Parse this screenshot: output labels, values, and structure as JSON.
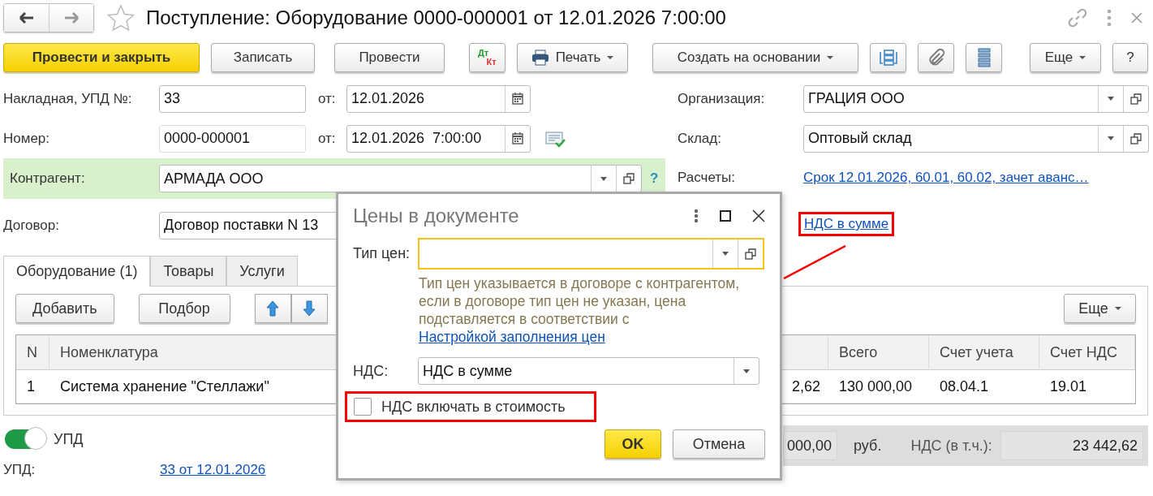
{
  "window": {
    "title": "Поступление: Оборудование 0000-000001 от 12.01.2026 7:00:00"
  },
  "toolbar": [
    {
      "kind": "primary",
      "label": "Провести и закрыть"
    },
    {
      "kind": "text",
      "label": "Записать"
    },
    {
      "kind": "text",
      "label": "Провести"
    },
    {
      "kind": "dtkt",
      "top": "Дт",
      "bottom": "Кт"
    },
    {
      "kind": "print",
      "label": "Печать"
    },
    {
      "kind": "menu",
      "label": "Создать на основании"
    },
    {
      "kind": "structure"
    },
    {
      "kind": "attach"
    },
    {
      "kind": "list"
    },
    {
      "kind": "menu",
      "label": "Еще"
    },
    {
      "kind": "text",
      "label": "?"
    }
  ],
  "invoice": {
    "label": "Накладная, УПД №:",
    "value": "33",
    "date_label": "от:",
    "date": "12.01.2026"
  },
  "number": {
    "label": "Номер:",
    "value": "0000-000001",
    "date_label": "от:",
    "date": "12.01.2026  7:00:00"
  },
  "counterparty": {
    "label": "Контрагент:",
    "value": "АРМАДА ООО",
    "help": "?"
  },
  "contract": {
    "label": "Договор:",
    "value": "Договор поставки N 13"
  },
  "organization": {
    "label": "Организация:",
    "value": "ГРАЦИЯ ООО"
  },
  "warehouse": {
    "label": "Склад:",
    "value": "Оптовый склад"
  },
  "settlements": {
    "label": "Расчеты:",
    "link": "Срок 12.01.2026, 60.01, 60.02, зачет аванс…"
  },
  "vat_link": "НДС в сумме",
  "tabs": [
    {
      "label": "Оборудование (1)",
      "selected": true
    },
    {
      "label": "Товары",
      "selected": false
    },
    {
      "label": "Услуги",
      "selected": false
    }
  ],
  "table_actions": {
    "add": "Добавить",
    "pick": "Подбор",
    "more": "Еще"
  },
  "table": {
    "columns": {
      "n": "N",
      "item": "Номенклатура",
      "total": "Всего",
      "account": "Счет учета",
      "vat_account": "Счет НДС"
    },
    "rows": [
      {
        "n": "1",
        "item": "Система хранение \"Стеллажи\"",
        "column_3": "2,62",
        "total": "130 000,00",
        "account": "08.04.1",
        "vat_account": "19.01"
      }
    ]
  },
  "upd": {
    "toggle_label": "УПД",
    "on": true,
    "label": "УПД:",
    "link": "33 от 12.01.2026"
  },
  "totals": {
    "amount": "000,00",
    "currency": "руб.",
    "vat_label": "НДС (в т.ч.):",
    "vat": "23 442,62"
  },
  "dialog": {
    "title": "Цены в документе",
    "price_type_label": "Тип цен:",
    "hint": "Тип цен указывается в договоре с контрагентом, если в договоре тип цен не указан, цена подставляется в соответствии с",
    "hint_link": "Настройкой заполнения цен",
    "vat_label": "НДС:",
    "vat_value": "НДС в сумме",
    "include_vat": {
      "label": "НДС включать в стоимость",
      "checked": false
    },
    "buttons": [
      {
        "kind": "primary",
        "label": "OK"
      },
      {
        "kind": "default",
        "label": "Отмена"
      }
    ]
  }
}
